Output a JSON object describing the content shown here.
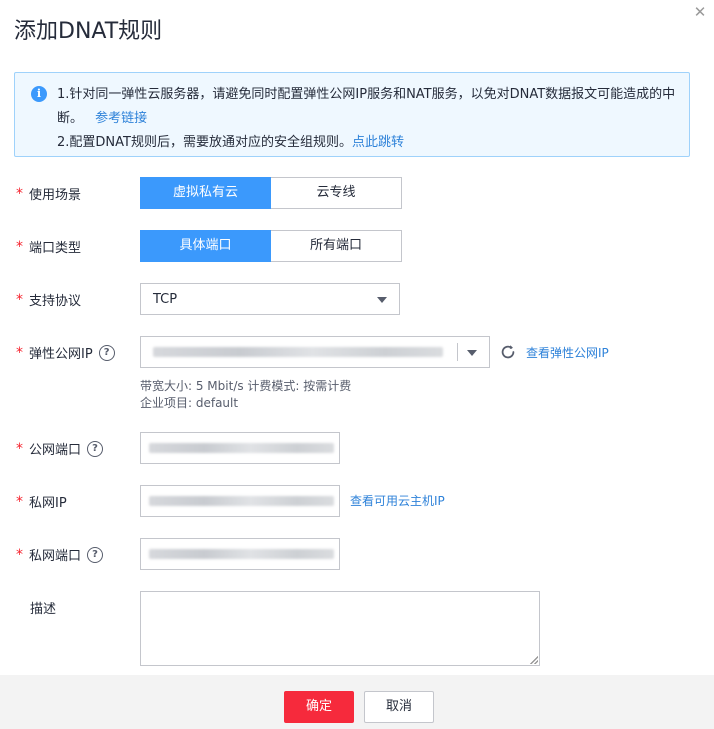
{
  "dialog": {
    "title": "添加DNAT规则",
    "close_icon": "close-icon"
  },
  "notice": {
    "line1": "1.针对同一弹性云服务器，请避免同时配置弹性公网IP服务和NAT服务，以免对DNAT数据报文可能造成的中断。",
    "line1_link": "参考链接",
    "line2": "2.配置DNAT规则后，需要放通对应的安全组规则。",
    "line2_link": "点此跳转"
  },
  "form": {
    "scenario": {
      "label": "使用场景",
      "options": [
        "虚拟私有云",
        "云专线"
      ],
      "selected": "虚拟私有云"
    },
    "port_type": {
      "label": "端口类型",
      "options": [
        "具体端口",
        "所有端口"
      ],
      "selected": "具体端口"
    },
    "protocol": {
      "label": "支持协议",
      "value": "TCP"
    },
    "eip": {
      "label": "弹性公网IP",
      "link": "查看弹性公网IP",
      "hint1": "带宽大小: 5 Mbit/s  计费模式: 按需计费",
      "hint2": "企业项目: default"
    },
    "public_port": {
      "label": "公网端口"
    },
    "private_ip": {
      "label": "私网IP",
      "link": "查看可用云主机IP"
    },
    "private_port": {
      "label": "私网端口"
    },
    "description": {
      "label": "描述",
      "value": ""
    }
  },
  "footer": {
    "confirm_label": "确定",
    "cancel_label": "取消"
  },
  "colors": {
    "primary": "#3b99fc",
    "danger": "#f62a3c",
    "link": "#2e82d9",
    "required": "#f5222d"
  }
}
